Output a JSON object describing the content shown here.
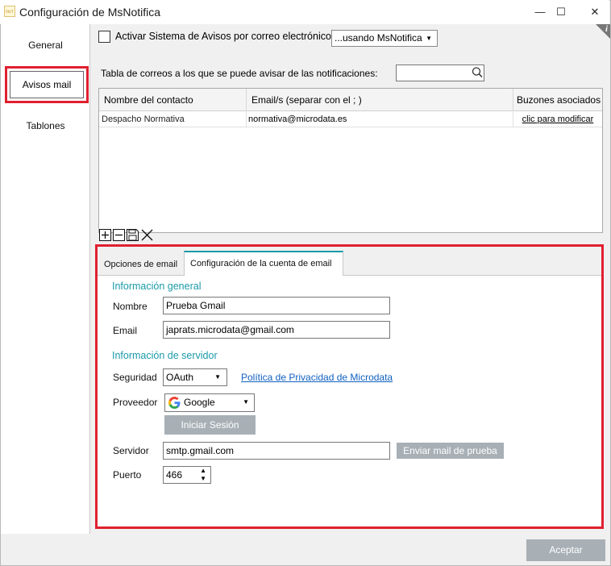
{
  "window": {
    "title": "Configuración de MsNotifica",
    "app_icon_text": "NoT",
    "minimize_glyph": "—",
    "maximize_glyph": "☐",
    "close_glyph": "✕"
  },
  "sidebar": {
    "items": [
      {
        "label": "General"
      },
      {
        "label": "Avisos mail",
        "selected": true
      },
      {
        "label": "Tablones"
      }
    ]
  },
  "info_badge": "i",
  "avisos": {
    "activar_label": "Activar Sistema de Avisos por correo electrónico",
    "activar_checked": false,
    "modo_selected": "...usando MsNotifica",
    "tabla_label": "Tabla de correos a los que se puede avisar de las notificaciones:",
    "search_value": "",
    "table": {
      "columns": [
        "Nombre del contacto",
        "Email/s  (separar con el ; )",
        "Buzones asociados"
      ],
      "rows": [
        [
          "Despacho Normativa",
          "normativa@microdata.es",
          "clic para modificar"
        ]
      ]
    }
  },
  "tabs": [
    {
      "label": "Opciones de email",
      "active": false
    },
    {
      "label": "Configuración de la cuenta de email",
      "active": true
    }
  ],
  "cuenta": {
    "info_general_title": "Información general",
    "nombre_label": "Nombre",
    "nombre_value": "Prueba Gmail",
    "email_label": "Email",
    "email_value": "japrats.microdata@gmail.com",
    "info_servidor_title": "Información de servidor",
    "seguridad_label": "Seguridad",
    "seguridad_value": "OAuth",
    "politica_link": "Política de Privacidad de Microdata",
    "proveedor_label": "Proveedor",
    "proveedor_value": "Google",
    "iniciar_sesion": "Iniciar Sesión",
    "servidor_label": "Servidor",
    "servidor_value": "smtp.gmail.com",
    "enviar_prueba": "Enviar mail de prueba",
    "puerto_label": "Puerto",
    "puerto_value": "466"
  },
  "footer": {
    "aceptar": "Aceptar"
  },
  "colors": {
    "highlight_red": "#e0202f",
    "accent_teal": "#1a9aa8",
    "link_blue": "#1060c0",
    "disabled_button": "#a8b0b6"
  }
}
